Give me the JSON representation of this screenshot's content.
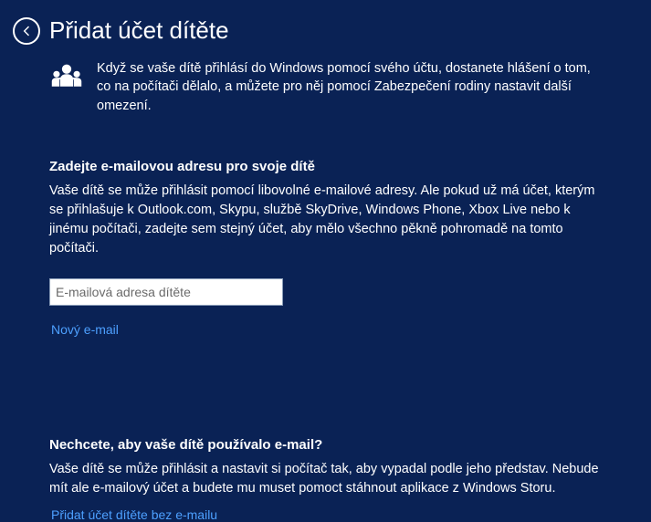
{
  "header": {
    "title": "Přidat účet dítěte"
  },
  "intro": {
    "text": "Když se vaše dítě přihlásí do Windows pomocí svého účtu, dostanete hlášení o tom, co na počítači dělalo, a můžete pro něj pomocí Zabezpečení rodiny nastavit další omezení."
  },
  "section_email": {
    "heading": "Zadejte e-mailovou adresu pro svoje dítě",
    "text": "Vaše dítě se může přihlásit pomocí libovolné e-mailové adresy. Ale pokud už má účet, kterým se přihlašuje k Outlook.com, Skypu, službě SkyDrive, Windows Phone, Xbox Live nebo k jinému počítači, zadejte sem stejný účet, aby mělo všechno pěkně pohromadě na tomto počítači.",
    "placeholder": "E-mailová adresa dítěte",
    "value": "",
    "new_email_link": "Nový e-mail"
  },
  "section_noemail": {
    "heading": "Nechcete, aby vaše dítě používalo e-mail?",
    "text": "Vaše dítě se může přihlásit a nastavit si počítač tak, aby vypadal podle jeho představ. Nebude mít ale e-mailový účet a budete mu muset pomoct stáhnout aplikace z Windows Storu.",
    "add_without_email_link": "Přidat účet dítěte bez e-mailu"
  }
}
